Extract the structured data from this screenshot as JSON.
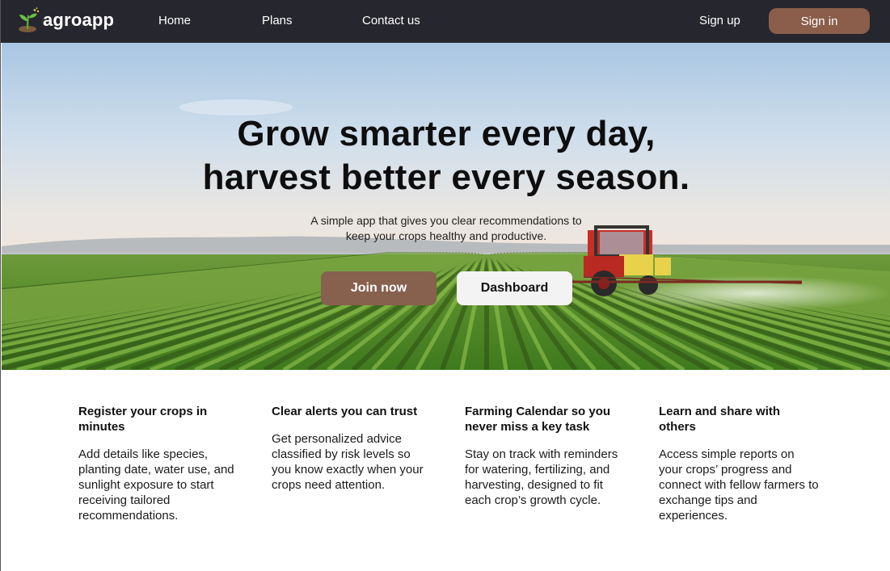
{
  "nav": {
    "logo_text": "agroapp",
    "logo_icon": "sprout-icon",
    "links": [
      "Home",
      "Plans",
      "Contact us"
    ],
    "signup_label": "Sign up",
    "signin_label": "Sign in"
  },
  "hero": {
    "title_lines": [
      "Grow smarter every day,",
      "harvest better every season."
    ],
    "subtitle_lines": [
      "A simple app that gives you clear recommendations to",
      "keep your crops healthy and productive."
    ],
    "join_label": "Join now",
    "dashboard_label": "Dashboard",
    "background": "crop-field-with-tractor-image"
  },
  "features": [
    {
      "title": "Register your crops in minutes",
      "body": "Add details like species, planting date, water use, and sunlight exposure to start receiving tailored recommendations."
    },
    {
      "title": "Clear alerts you can trust",
      "body": "Get personalized advice classified by risk levels so you know exactly when your crops need attention."
    },
    {
      "title": "Farming Calendar so you never miss a key task",
      "body": "Stay on track with reminders for watering, fertilizing, and harvesting, designed to fit each crop’s growth cycle."
    },
    {
      "title": "Learn and share with others",
      "body": "Access simple reports on your crops’ progress and connect with fellow farmers to exchange tips and experiences."
    }
  ],
  "colors": {
    "navbar": "#26262e",
    "accent_brown": "#8a5e4a",
    "button_light": "#f3f3f3"
  }
}
